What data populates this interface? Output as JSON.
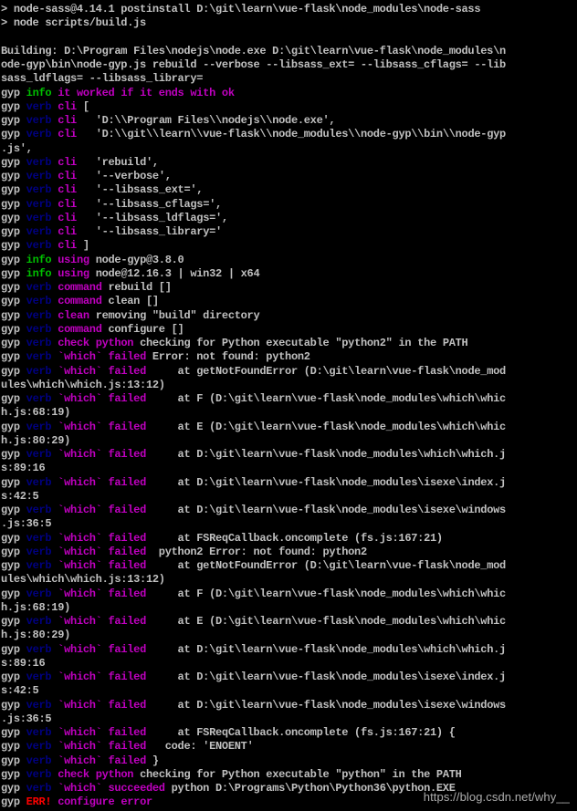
{
  "colors": {
    "text": "#c0c0c0",
    "gyp": "#c0c0c0",
    "info": "#00c000",
    "verb": "#000080",
    "magenta": "#c000c0",
    "err": "#ff0000",
    "background": "#000000"
  },
  "terminal": {
    "lines": [
      [
        [
          "> node-sass@4.14.1 postinstall D:\\git\\learn\\vue-flask\\node_modules\\node-sass",
          "text"
        ]
      ],
      [
        [
          "> node scripts/build.js",
          "text"
        ]
      ],
      [
        [
          "",
          "text"
        ]
      ],
      [
        [
          "Building: D:\\Program Files\\nodejs\\node.exe D:\\git\\learn\\vue-flask\\node_modules\\n",
          "text"
        ]
      ],
      [
        [
          "ode-gyp\\bin\\node-gyp.js rebuild --verbose --libsass_ext= --libsass_cflags= --lib",
          "text"
        ]
      ],
      [
        [
          "sass_ldflags= --libsass_library=",
          "text"
        ]
      ],
      [
        [
          "gyp ",
          "gyp"
        ],
        [
          "info",
          "info"
        ],
        [
          " it worked if it ends with ok",
          "magenta"
        ]
      ],
      [
        [
          "gyp ",
          "gyp"
        ],
        [
          "verb",
          "verb"
        ],
        [
          " cli",
          "magenta"
        ],
        [
          " [",
          "text"
        ]
      ],
      [
        [
          "gyp ",
          "gyp"
        ],
        [
          "verb",
          "verb"
        ],
        [
          " cli",
          "magenta"
        ],
        [
          "   'D:\\\\Program Files\\\\nodejs\\\\node.exe',",
          "text"
        ]
      ],
      [
        [
          "gyp ",
          "gyp"
        ],
        [
          "verb",
          "verb"
        ],
        [
          " cli",
          "magenta"
        ],
        [
          "   'D:\\\\git\\\\learn\\\\vue-flask\\\\node_modules\\\\node-gyp\\\\bin\\\\node-gyp",
          "text"
        ]
      ],
      [
        [
          ".js',",
          "text"
        ]
      ],
      [
        [
          "gyp ",
          "gyp"
        ],
        [
          "verb",
          "verb"
        ],
        [
          " cli",
          "magenta"
        ],
        [
          "   'rebuild',",
          "text"
        ]
      ],
      [
        [
          "gyp ",
          "gyp"
        ],
        [
          "verb",
          "verb"
        ],
        [
          " cli",
          "magenta"
        ],
        [
          "   '--verbose',",
          "text"
        ]
      ],
      [
        [
          "gyp ",
          "gyp"
        ],
        [
          "verb",
          "verb"
        ],
        [
          " cli",
          "magenta"
        ],
        [
          "   '--libsass_ext=',",
          "text"
        ]
      ],
      [
        [
          "gyp ",
          "gyp"
        ],
        [
          "verb",
          "verb"
        ],
        [
          " cli",
          "magenta"
        ],
        [
          "   '--libsass_cflags=',",
          "text"
        ]
      ],
      [
        [
          "gyp ",
          "gyp"
        ],
        [
          "verb",
          "verb"
        ],
        [
          " cli",
          "magenta"
        ],
        [
          "   '--libsass_ldflags=',",
          "text"
        ]
      ],
      [
        [
          "gyp ",
          "gyp"
        ],
        [
          "verb",
          "verb"
        ],
        [
          " cli",
          "magenta"
        ],
        [
          "   '--libsass_library='",
          "text"
        ]
      ],
      [
        [
          "gyp ",
          "gyp"
        ],
        [
          "verb",
          "verb"
        ],
        [
          " cli",
          "magenta"
        ],
        [
          " ]",
          "text"
        ]
      ],
      [
        [
          "gyp ",
          "gyp"
        ],
        [
          "info",
          "info"
        ],
        [
          " using",
          "magenta"
        ],
        [
          " node-gyp@3.8.0",
          "text"
        ]
      ],
      [
        [
          "gyp ",
          "gyp"
        ],
        [
          "info",
          "info"
        ],
        [
          " using",
          "magenta"
        ],
        [
          " node@12.16.3 | win32 | x64",
          "text"
        ]
      ],
      [
        [
          "gyp ",
          "gyp"
        ],
        [
          "verb",
          "verb"
        ],
        [
          " command",
          "magenta"
        ],
        [
          " rebuild []",
          "text"
        ]
      ],
      [
        [
          "gyp ",
          "gyp"
        ],
        [
          "verb",
          "verb"
        ],
        [
          " command",
          "magenta"
        ],
        [
          " clean []",
          "text"
        ]
      ],
      [
        [
          "gyp ",
          "gyp"
        ],
        [
          "verb",
          "verb"
        ],
        [
          " clean",
          "magenta"
        ],
        [
          " removing \"build\" directory",
          "text"
        ]
      ],
      [
        [
          "gyp ",
          "gyp"
        ],
        [
          "verb",
          "verb"
        ],
        [
          " command",
          "magenta"
        ],
        [
          " configure []",
          "text"
        ]
      ],
      [
        [
          "gyp ",
          "gyp"
        ],
        [
          "verb",
          "verb"
        ],
        [
          " check python",
          "magenta"
        ],
        [
          " checking for Python executable \"python2\" in the PATH",
          "text"
        ]
      ],
      [
        [
          "gyp ",
          "gyp"
        ],
        [
          "verb",
          "verb"
        ],
        [
          " `which` failed",
          "magenta"
        ],
        [
          " Error: not found: python2",
          "text"
        ]
      ],
      [
        [
          "gyp ",
          "gyp"
        ],
        [
          "verb",
          "verb"
        ],
        [
          " `which` failed",
          "magenta"
        ],
        [
          "     at getNotFoundError (D:\\git\\learn\\vue-flask\\node_mod",
          "text"
        ]
      ],
      [
        [
          "ules\\which\\which.js:13:12)",
          "text"
        ]
      ],
      [
        [
          "gyp ",
          "gyp"
        ],
        [
          "verb",
          "verb"
        ],
        [
          " `which` failed",
          "magenta"
        ],
        [
          "     at F (D:\\git\\learn\\vue-flask\\node_modules\\which\\whic",
          "text"
        ]
      ],
      [
        [
          "h.js:68:19)",
          "text"
        ]
      ],
      [
        [
          "gyp ",
          "gyp"
        ],
        [
          "verb",
          "verb"
        ],
        [
          " `which` failed",
          "magenta"
        ],
        [
          "     at E (D:\\git\\learn\\vue-flask\\node_modules\\which\\whic",
          "text"
        ]
      ],
      [
        [
          "h.js:80:29)",
          "text"
        ]
      ],
      [
        [
          "gyp ",
          "gyp"
        ],
        [
          "verb",
          "verb"
        ],
        [
          " `which` failed",
          "magenta"
        ],
        [
          "     at D:\\git\\learn\\vue-flask\\node_modules\\which\\which.j",
          "text"
        ]
      ],
      [
        [
          "s:89:16",
          "text"
        ]
      ],
      [
        [
          "gyp ",
          "gyp"
        ],
        [
          "verb",
          "verb"
        ],
        [
          " `which` failed",
          "magenta"
        ],
        [
          "     at D:\\git\\learn\\vue-flask\\node_modules\\isexe\\index.j",
          "text"
        ]
      ],
      [
        [
          "s:42:5",
          "text"
        ]
      ],
      [
        [
          "gyp ",
          "gyp"
        ],
        [
          "verb",
          "verb"
        ],
        [
          " `which` failed",
          "magenta"
        ],
        [
          "     at D:\\git\\learn\\vue-flask\\node_modules\\isexe\\windows",
          "text"
        ]
      ],
      [
        [
          ".js:36:5",
          "text"
        ]
      ],
      [
        [
          "gyp ",
          "gyp"
        ],
        [
          "verb",
          "verb"
        ],
        [
          " `which` failed",
          "magenta"
        ],
        [
          "     at FSReqCallback.oncomplete (fs.js:167:21)",
          "text"
        ]
      ],
      [
        [
          "gyp ",
          "gyp"
        ],
        [
          "verb",
          "verb"
        ],
        [
          " `which` failed",
          "magenta"
        ],
        [
          "  python2 Error: not found: python2",
          "text"
        ]
      ],
      [
        [
          "gyp ",
          "gyp"
        ],
        [
          "verb",
          "verb"
        ],
        [
          " `which` failed",
          "magenta"
        ],
        [
          "     at getNotFoundError (D:\\git\\learn\\vue-flask\\node_mod",
          "text"
        ]
      ],
      [
        [
          "ules\\which\\which.js:13:12)",
          "text"
        ]
      ],
      [
        [
          "gyp ",
          "gyp"
        ],
        [
          "verb",
          "verb"
        ],
        [
          " `which` failed",
          "magenta"
        ],
        [
          "     at F (D:\\git\\learn\\vue-flask\\node_modules\\which\\whic",
          "text"
        ]
      ],
      [
        [
          "h.js:68:19)",
          "text"
        ]
      ],
      [
        [
          "gyp ",
          "gyp"
        ],
        [
          "verb",
          "verb"
        ],
        [
          " `which` failed",
          "magenta"
        ],
        [
          "     at E (D:\\git\\learn\\vue-flask\\node_modules\\which\\whic",
          "text"
        ]
      ],
      [
        [
          "h.js:80:29)",
          "text"
        ]
      ],
      [
        [
          "gyp ",
          "gyp"
        ],
        [
          "verb",
          "verb"
        ],
        [
          " `which` failed",
          "magenta"
        ],
        [
          "     at D:\\git\\learn\\vue-flask\\node_modules\\which\\which.j",
          "text"
        ]
      ],
      [
        [
          "s:89:16",
          "text"
        ]
      ],
      [
        [
          "gyp ",
          "gyp"
        ],
        [
          "verb",
          "verb"
        ],
        [
          " `which` failed",
          "magenta"
        ],
        [
          "     at D:\\git\\learn\\vue-flask\\node_modules\\isexe\\index.j",
          "text"
        ]
      ],
      [
        [
          "s:42:5",
          "text"
        ]
      ],
      [
        [
          "gyp ",
          "gyp"
        ],
        [
          "verb",
          "verb"
        ],
        [
          " `which` failed",
          "magenta"
        ],
        [
          "     at D:\\git\\learn\\vue-flask\\node_modules\\isexe\\windows",
          "text"
        ]
      ],
      [
        [
          ".js:36:5",
          "text"
        ]
      ],
      [
        [
          "gyp ",
          "gyp"
        ],
        [
          "verb",
          "verb"
        ],
        [
          " `which` failed",
          "magenta"
        ],
        [
          "     at FSReqCallback.oncomplete (fs.js:167:21) {",
          "text"
        ]
      ],
      [
        [
          "gyp ",
          "gyp"
        ],
        [
          "verb",
          "verb"
        ],
        [
          " `which` failed",
          "magenta"
        ],
        [
          "   code: 'ENOENT'",
          "text"
        ]
      ],
      [
        [
          "gyp ",
          "gyp"
        ],
        [
          "verb",
          "verb"
        ],
        [
          " `which` failed",
          "magenta"
        ],
        [
          " }",
          "text"
        ]
      ],
      [
        [
          "gyp ",
          "gyp"
        ],
        [
          "verb",
          "verb"
        ],
        [
          " check python",
          "magenta"
        ],
        [
          " checking for Python executable \"python\" in the PATH",
          "text"
        ]
      ],
      [
        [
          "gyp ",
          "gyp"
        ],
        [
          "verb",
          "verb"
        ],
        [
          " `which` succeeded",
          "magenta"
        ],
        [
          " python D:\\Programs\\Python\\Python36\\python.EXE",
          "text"
        ]
      ],
      [
        [
          "gyp ",
          "gyp"
        ],
        [
          "ERR!",
          "err"
        ],
        [
          " configure error",
          "magenta"
        ]
      ]
    ]
  },
  "watermark": "https://blog.csdn.net/why__"
}
